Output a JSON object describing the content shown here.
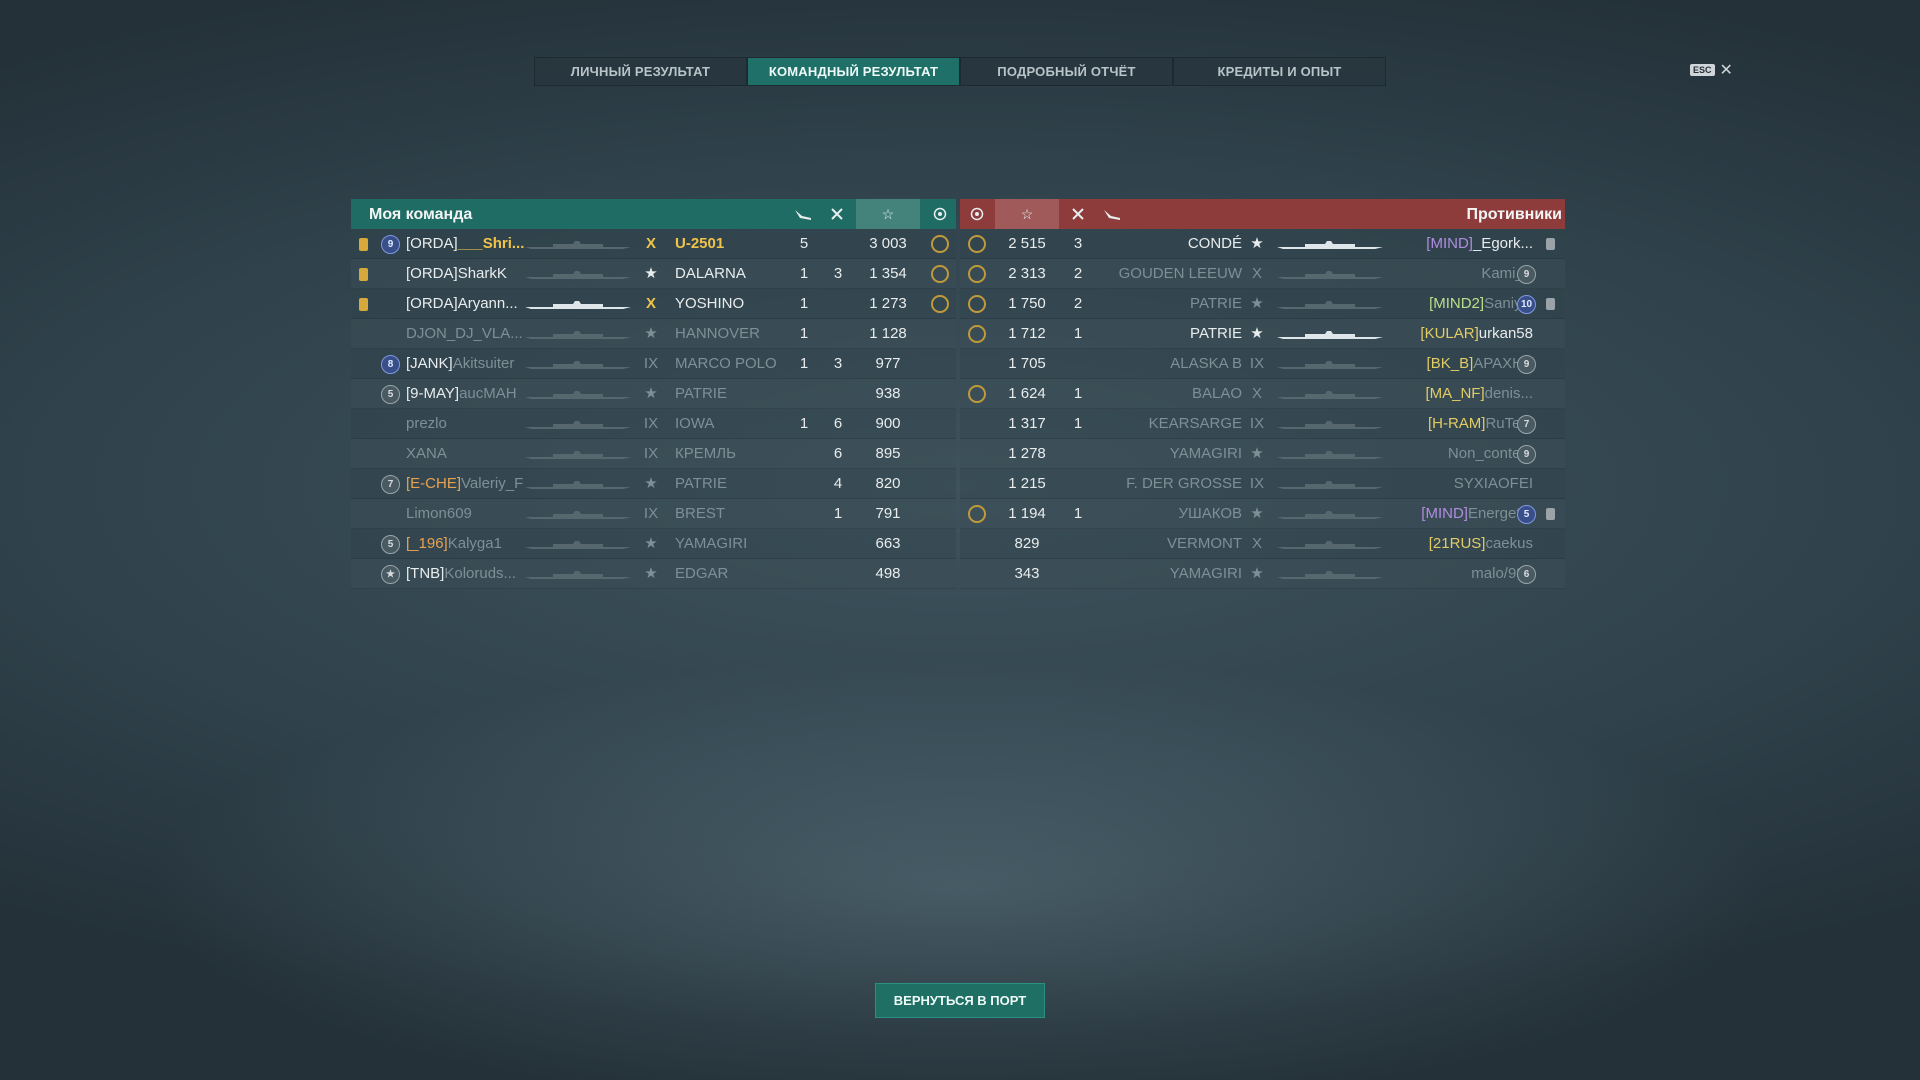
{
  "tabs": [
    "ЛИЧНЫЙ РЕЗУЛЬТАТ",
    "КОМАНДНЫЙ РЕЗУЛЬТАТ",
    "ПОДРОБНЫЙ ОТЧЁТ",
    "КРЕДИТЫ И ОПЫТ"
  ],
  "active_tab": "КОМАНДНЫЙ РЕЗУЛЬТАТ",
  "esc_label": "ESC",
  "my_team": {
    "title": "Моя команда",
    "rows": [
      {
        "clan": "[ORDA]",
        "name": "___Shri...",
        "tier": "X",
        "ship": "U-2501",
        "planes": "5",
        "frags": "",
        "xp": "3 003",
        "self": true,
        "icon": "orange",
        "rank": "9"
      },
      {
        "clan": "[ORDA]",
        "name": "SharkK",
        "tier": "★",
        "ship": "DALARNA",
        "planes": "1",
        "frags": "3",
        "xp": "1 354",
        "icon": "orange",
        "rank": ""
      },
      {
        "clan": "[ORDA]",
        "name": "Aryann...",
        "tier": "X",
        "ship": "YOSHINO",
        "planes": "1",
        "frags": "",
        "xp": "1 273",
        "icon": "orange",
        "rank": ""
      },
      {
        "clan": "",
        "name": "DJON_DJ_VLA...",
        "tier": "★",
        "ship": "HANNOVER",
        "planes": "1",
        "frags": "",
        "xp": "1 128",
        "icon": "",
        "rank": ""
      },
      {
        "clan": "[JANK]",
        "name": "Akitsuiter",
        "tier": "IX",
        "ship": "MARCO POLO",
        "planes": "1",
        "frags": "3",
        "xp": "977",
        "icon": "",
        "rank": "8"
      },
      {
        "clan": "[9-MAY]",
        "name": "aucMAH",
        "tier": "★",
        "ship": "PATRIE",
        "planes": "",
        "frags": "",
        "xp": "938",
        "icon": "",
        "rank": "5"
      },
      {
        "clan": "",
        "name": "prezlo",
        "tier": "IX",
        "ship": "IOWA",
        "planes": "1",
        "frags": "6",
        "xp": "900",
        "icon": "",
        "rank": ""
      },
      {
        "clan": "",
        "name": "XANA",
        "tier": "IX",
        "ship": "КРЕМЛЬ",
        "planes": "",
        "frags": "6",
        "xp": "895",
        "icon": "",
        "rank": ""
      },
      {
        "clan": "[E-CHE]",
        "name": "Valeriy_F",
        "tier": "★",
        "ship": "PATRIE",
        "planes": "",
        "frags": "4",
        "xp": "820",
        "icon": "",
        "rank": "7"
      },
      {
        "clan": "",
        "name": "Limon609",
        "tier": "IX",
        "ship": "BREST",
        "planes": "",
        "frags": "1",
        "xp": "791",
        "icon": "",
        "rank": ""
      },
      {
        "clan": "[_196]",
        "name": "Kalyga1",
        "tier": "★",
        "ship": "YAMAGIRI",
        "planes": "",
        "frags": "",
        "xp": "663",
        "icon": "",
        "rank": "5"
      },
      {
        "clan": "[TNB]",
        "name": "Koloruds...",
        "tier": "★",
        "ship": "EDGAR",
        "planes": "",
        "frags": "",
        "xp": "498",
        "icon": "",
        "rank": "★"
      }
    ]
  },
  "enemies": {
    "title": "Противники",
    "rows": [
      {
        "xp": "2 515",
        "frags": "3",
        "planes": "",
        "ship": "CONDÉ",
        "tier": "★",
        "clan": "[MIND]",
        "name": "_Egork...",
        "rank": "",
        "pin": true
      },
      {
        "xp": "2 313",
        "frags": "2",
        "planes": "",
        "ship": "GOUDEN LEEUW",
        "tier": "X",
        "clan": "",
        "name": "Kami_T",
        "rank": "9",
        "pin": false
      },
      {
        "xp": "1 750",
        "frags": "2",
        "planes": "",
        "ship": "PATRIE",
        "tier": "★",
        "clan": "[MIND2]",
        "name": "Saniy...",
        "rank": "10",
        "pin": true
      },
      {
        "xp": "1 712",
        "frags": "1",
        "planes": "",
        "ship": "PATRIE",
        "tier": "★",
        "clan": "[KULAR]",
        "name": "urkan58",
        "rank": "",
        "pin": false
      },
      {
        "xp": "1 705",
        "frags": "",
        "planes": "",
        "ship": "ALASKA B",
        "tier": "IX",
        "clan": "[BK_B]",
        "name": "APAXHA",
        "rank": "9",
        "pin": false
      },
      {
        "xp": "1 624",
        "frags": "1",
        "planes": "",
        "ship": "BALAO",
        "tier": "X",
        "clan": "[MA_NF]",
        "name": "denis...",
        "rank": "",
        "pin": false
      },
      {
        "xp": "1 317",
        "frags": "1",
        "planes": "",
        "ship": "KEARSARGE",
        "tier": "IX",
        "clan": "[H-RAM]",
        "name": "RuTe...",
        "rank": "7",
        "pin": false
      },
      {
        "xp": "1 278",
        "frags": "",
        "planes": "",
        "ship": "YAMAGIRI",
        "tier": "★",
        "clan": "",
        "name": "Non_content",
        "rank": "9",
        "pin": false
      },
      {
        "xp": "1 215",
        "frags": "",
        "planes": "",
        "ship": "F. DER GROSSE",
        "tier": "IX",
        "clan": "",
        "name": "SYXIAOFEI",
        "rank": "",
        "pin": false
      },
      {
        "xp": "1 194",
        "frags": "1",
        "planes": "",
        "ship": "УШАКОВ",
        "tier": "★",
        "clan": "[MIND]",
        "name": "Energet...",
        "rank": "5",
        "pin": true
      },
      {
        "xp": "829",
        "frags": "",
        "planes": "",
        "ship": "VERMONT",
        "tier": "X",
        "clan": "[21RUS]",
        "name": "caekus",
        "rank": "",
        "pin": false
      },
      {
        "xp": "343",
        "frags": "",
        "planes": "",
        "ship": "YAMAGIRI",
        "tier": "★",
        "clan": "",
        "name": "malo/983",
        "rank": "6",
        "pin": false
      }
    ]
  },
  "return_button": "ВЕРНУТЬСЯ В ПОРТ"
}
